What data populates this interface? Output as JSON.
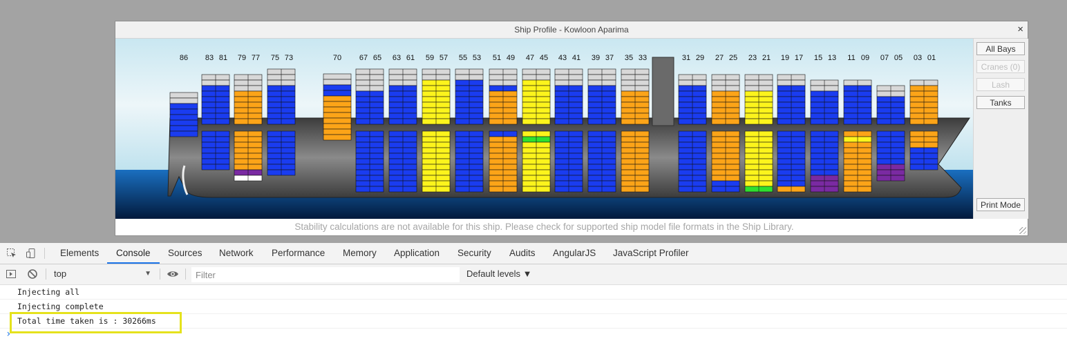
{
  "modal": {
    "title": "Ship Profile - Kowloon Aparima",
    "close_label": "×",
    "footer_message": "Stability calculations are not available for this ship. Please check for supported ship model file formats in the Ship Library."
  },
  "side_buttons": {
    "all_bays": "All Bays",
    "cranes": "Cranes (0)",
    "lash": "Lash",
    "tanks": "Tanks",
    "print_mode": "Print Mode"
  },
  "colors": {
    "blue": "#1a3cf0",
    "orange": "#fca418",
    "yellow": "#fcf41c",
    "purple": "#7a2aa2",
    "green": "#2fe02f",
    "empty": "#d8d8d8",
    "white": "#ffffff",
    "hull": "#5c5c5c",
    "sea": "#0a3c7c",
    "sky": "#d9eef4"
  },
  "bays": [
    {
      "labels": [
        "86"
      ],
      "deck": [
        "E",
        "E",
        "B",
        "B",
        "B",
        "B",
        "B",
        "B"
      ],
      "hold": []
    },
    {
      "labels": [
        "83",
        "81"
      ],
      "deck": [
        "E",
        "E",
        "B",
        "B",
        "B",
        "B",
        "B",
        "B",
        "B"
      ],
      "hold": [
        "B",
        "B",
        "B",
        "B",
        "B",
        "B",
        "B"
      ]
    },
    {
      "labels": [
        "79",
        "77"
      ],
      "deck": [
        "E",
        "E",
        "E",
        "O",
        "O",
        "O",
        "O",
        "O",
        "O"
      ],
      "hold": [
        "O",
        "O",
        "O",
        "O",
        "O",
        "O",
        "O",
        "P",
        "W"
      ]
    },
    {
      "labels": [
        "75",
        "73"
      ],
      "deck": [
        "E",
        "E",
        "E",
        "B",
        "B",
        "B",
        "B",
        "B",
        "B",
        "B"
      ],
      "hold": [
        "B",
        "B",
        "B",
        "B",
        "B",
        "B",
        "B",
        "B"
      ]
    },
    {
      "labels": [
        "70"
      ],
      "deck": [
        "E",
        "E",
        "B",
        "B",
        "O",
        "O",
        "O",
        "O",
        "O",
        "O",
        "O",
        "O"
      ],
      "hold": []
    },
    {
      "labels": [
        "67",
        "65"
      ],
      "deck": [
        "E",
        "E",
        "E",
        "E",
        "B",
        "B",
        "B",
        "B",
        "B",
        "B"
      ],
      "hold": [
        "B",
        "B",
        "B",
        "B",
        "B",
        "B",
        "B",
        "B",
        "B",
        "B",
        "B"
      ]
    },
    {
      "labels": [
        "63",
        "61"
      ],
      "deck": [
        "E",
        "E",
        "E",
        "B",
        "B",
        "B",
        "B",
        "B",
        "B",
        "B"
      ],
      "hold": [
        "B",
        "B",
        "B",
        "B",
        "B",
        "B",
        "B",
        "B",
        "B",
        "B",
        "B"
      ]
    },
    {
      "labels": [
        "59",
        "57"
      ],
      "deck": [
        "E",
        "E",
        "Y",
        "Y",
        "Y",
        "Y",
        "Y",
        "Y",
        "Y",
        "Y"
      ],
      "hold": [
        "Y",
        "Y",
        "Y",
        "Y",
        "Y",
        "Y",
        "Y",
        "Y",
        "Y",
        "Y",
        "Y"
      ]
    },
    {
      "labels": [
        "55",
        "53"
      ],
      "deck": [
        "E",
        "E",
        "B",
        "B",
        "B",
        "B",
        "B",
        "B",
        "B",
        "B"
      ],
      "hold": [
        "B",
        "B",
        "B",
        "B",
        "B",
        "B",
        "B",
        "B",
        "B",
        "B",
        "B"
      ]
    },
    {
      "labels": [
        "51",
        "49"
      ],
      "deck": [
        "E",
        "E",
        "E",
        "B",
        "O",
        "O",
        "O",
        "O",
        "O",
        "O"
      ],
      "hold": [
        "B",
        "O",
        "O",
        "O",
        "O",
        "O",
        "O",
        "O",
        "O",
        "O",
        "O"
      ]
    },
    {
      "labels": [
        "47",
        "45"
      ],
      "deck": [
        "E",
        "E",
        "Y",
        "Y",
        "Y",
        "Y",
        "Y",
        "Y",
        "Y",
        "Y"
      ],
      "hold": [
        "Y",
        "G",
        "Y",
        "Y",
        "Y",
        "Y",
        "Y",
        "Y",
        "Y",
        "Y",
        "Y"
      ]
    },
    {
      "labels": [
        "43",
        "41"
      ],
      "deck": [
        "E",
        "E",
        "E",
        "B",
        "B",
        "B",
        "B",
        "B",
        "B",
        "B"
      ],
      "hold": [
        "B",
        "B",
        "B",
        "B",
        "B",
        "B",
        "B",
        "B",
        "B",
        "B",
        "B"
      ]
    },
    {
      "labels": [
        "39",
        "37"
      ],
      "deck": [
        "E",
        "E",
        "E",
        "B",
        "B",
        "B",
        "B",
        "B",
        "B",
        "B"
      ],
      "hold": [
        "B",
        "B",
        "B",
        "B",
        "B",
        "B",
        "B",
        "B",
        "B",
        "B",
        "B"
      ]
    },
    {
      "labels": [
        "35",
        "33"
      ],
      "deck": [
        "E",
        "E",
        "E",
        "E",
        "O",
        "O",
        "O",
        "O",
        "O",
        "O"
      ],
      "hold": [
        "O",
        "O",
        "O",
        "O",
        "O",
        "O",
        "O",
        "O",
        "O",
        "O",
        "O"
      ]
    },
    {
      "labels": [
        "31",
        "29"
      ],
      "deck": [
        "E",
        "E",
        "B",
        "B",
        "B",
        "B",
        "B",
        "B",
        "B"
      ],
      "hold": [
        "B",
        "B",
        "B",
        "B",
        "B",
        "B",
        "B",
        "B",
        "B",
        "B",
        "B"
      ]
    },
    {
      "labels": [
        "27",
        "25"
      ],
      "deck": [
        "E",
        "E",
        "E",
        "O",
        "O",
        "O",
        "O",
        "O",
        "O"
      ],
      "hold": [
        "O",
        "O",
        "O",
        "O",
        "O",
        "O",
        "O",
        "O",
        "O",
        "B",
        "B"
      ]
    },
    {
      "labels": [
        "23",
        "21"
      ],
      "deck": [
        "E",
        "E",
        "E",
        "Y",
        "Y",
        "Y",
        "Y",
        "Y",
        "Y"
      ],
      "hold": [
        "Y",
        "Y",
        "Y",
        "Y",
        "Y",
        "Y",
        "Y",
        "Y",
        "Y",
        "Y",
        "G"
      ]
    },
    {
      "labels": [
        "19",
        "17"
      ],
      "deck": [
        "E",
        "E",
        "B",
        "B",
        "B",
        "B",
        "B",
        "B",
        "B"
      ],
      "hold": [
        "B",
        "B",
        "B",
        "B",
        "B",
        "B",
        "B",
        "B",
        "B",
        "B",
        "O"
      ]
    },
    {
      "labels": [
        "15",
        "13"
      ],
      "deck": [
        "E",
        "E",
        "B",
        "B",
        "B",
        "B",
        "B",
        "B"
      ],
      "hold": [
        "B",
        "B",
        "B",
        "B",
        "B",
        "B",
        "B",
        "B",
        "P",
        "P",
        "P"
      ]
    },
    {
      "labels": [
        "11",
        "09"
      ],
      "deck": [
        "E",
        "B",
        "B",
        "B",
        "B",
        "B",
        "B",
        "B"
      ],
      "hold": [
        "O",
        "Y",
        "O",
        "O",
        "O",
        "O",
        "O",
        "O",
        "O",
        "O",
        "O"
      ]
    },
    {
      "labels": [
        "07",
        "05"
      ],
      "deck": [
        "E",
        "E",
        "B",
        "B",
        "B",
        "B",
        "B"
      ],
      "hold": [
        "B",
        "B",
        "B",
        "B",
        "B",
        "B",
        "P",
        "P",
        "P"
      ]
    },
    {
      "labels": [
        "03",
        "01"
      ],
      "deck": [
        "E",
        "O",
        "O",
        "O",
        "O",
        "O",
        "O",
        "O"
      ],
      "hold": [
        "O",
        "O",
        "O",
        "B",
        "B",
        "B",
        "B"
      ]
    }
  ],
  "devtools": {
    "tabs": [
      "Elements",
      "Console",
      "Sources",
      "Network",
      "Performance",
      "Memory",
      "Application",
      "Security",
      "Audits",
      "AngularJS",
      "JavaScript Profiler"
    ],
    "active_tab": "Console",
    "context": "top",
    "filter_placeholder": "Filter",
    "levels": "Default levels ▼",
    "log": [
      "Injecting all",
      "Injecting complete",
      "Total time taken is : 30266ms"
    ],
    "prompt": "›"
  }
}
